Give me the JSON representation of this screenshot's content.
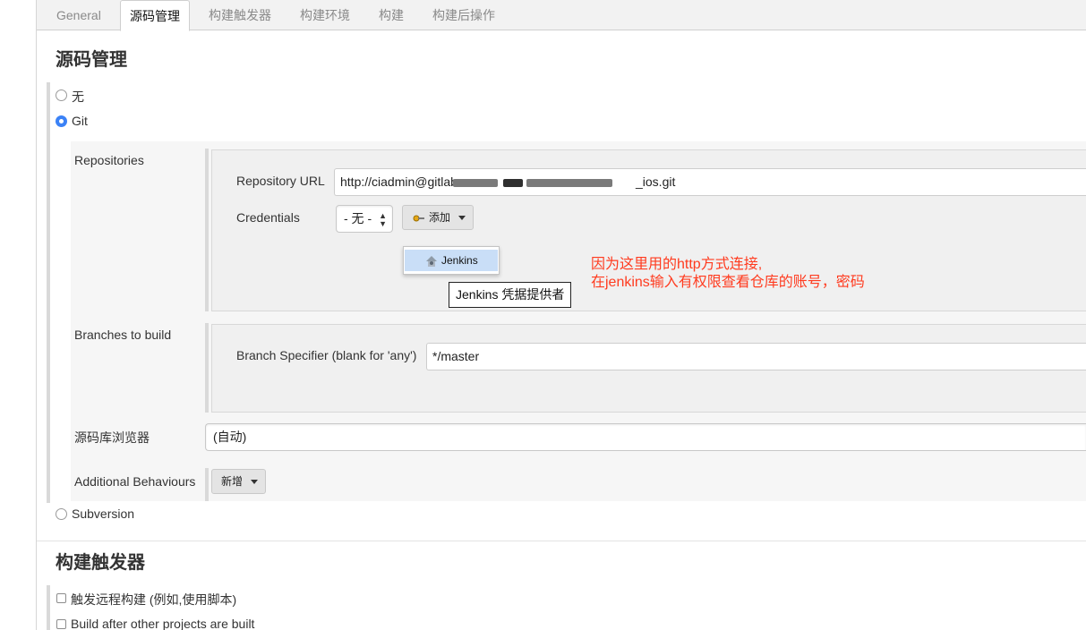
{
  "tabs": [
    {
      "label": "General"
    },
    {
      "label": "源码管理"
    },
    {
      "label": "构建触发器"
    },
    {
      "label": "构建环境"
    },
    {
      "label": "构建"
    },
    {
      "label": "构建后操作"
    }
  ],
  "scm": {
    "title": "源码管理",
    "options": {
      "none": "无",
      "git": "Git",
      "subversion": "Subversion"
    },
    "selected": "Git",
    "repositories_label": "Repositories",
    "repo_url_label": "Repository URL",
    "repo_url_start": "http://ciadmin@gitlab",
    "repo_url_end": "_ios.git",
    "credentials_label": "Credentials",
    "credentials_value": "- 无 -",
    "add_button": "添加",
    "add_menu_item": "Jenkins",
    "tooltip": "Jenkins 凭据提供者",
    "branches_label": "Branches to build",
    "branch_specifier_label": "Branch Specifier (blank for 'any')",
    "branch_specifier_value": "*/master",
    "browser_label": "源码库浏览器",
    "browser_value": "(自动)",
    "behaviours_label": "Additional Behaviours",
    "behaviours_button": "新增"
  },
  "annotation": {
    "line1": "因为这里用的http方式连接,",
    "line2": "在jenkins输入有权限查看仓库的账号，密码",
    "color": "#ff3b1f"
  },
  "triggers": {
    "title": "构建触发器",
    "items": [
      {
        "label": "触发远程构建 (例如,使用脚本)"
      },
      {
        "label": "Build after other projects are built"
      }
    ]
  },
  "colors": {
    "accent": "#3b82f6",
    "menu_highlight": "#c9def7"
  },
  "icons": {
    "add": "key-icon",
    "jenkins": "jenkins-butler-icon",
    "dropdown": "chevron-down-icon"
  }
}
